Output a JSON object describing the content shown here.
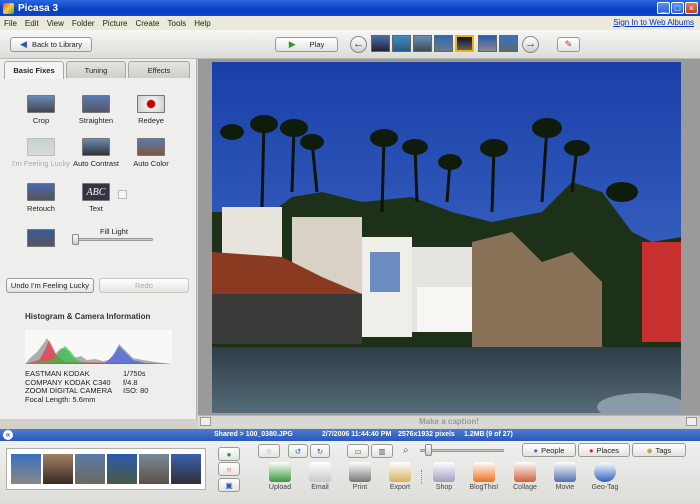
{
  "window": {
    "title": "Picasa 3"
  },
  "menu": {
    "items": [
      "File",
      "Edit",
      "View",
      "Folder",
      "Picture",
      "Create",
      "Tools",
      "Help"
    ],
    "signin": "Sign In to Web Albums"
  },
  "toolbar": {
    "back_label": "Back to Library",
    "play_label": "Play"
  },
  "tabs": [
    {
      "label": "Basic Fixes"
    },
    {
      "label": "Tuning"
    },
    {
      "label": "Effects"
    }
  ],
  "tools": {
    "crop": "Crop",
    "straighten": "Straighten",
    "redeye": "Redeye",
    "lucky": "I'm Feeling Lucky",
    "autocontrast": "Auto Contrast",
    "autocolor": "Auto Color",
    "retouch": "Retouch",
    "text": "Text",
    "filllight": "Fill Light",
    "text_icon": "ABC"
  },
  "buttons": {
    "undo": "Undo I'm Feeling Lucky",
    "redo": "Redo"
  },
  "histogram": {
    "title": "Histogram & Camera Information",
    "camera": [
      "EASTMAN KODAK",
      "COMPANY KODAK C340",
      "ZOOM DIGITAL CAMERA",
      "Focal Length: 5.6mm"
    ],
    "exposure": [
      "1/750s",
      "f/4.8",
      "ISO: 80"
    ]
  },
  "caption": {
    "placeholder": "Make a caption!"
  },
  "infobar": {
    "path": "Shared > 100_0380.JPG",
    "datetime": "2/7/2006 11:44:40 PM",
    "dimensions": "2576x1932 pixels",
    "size": "1.2MB",
    "position": "(9 of 27)"
  },
  "bottom_tabs": {
    "people": "People",
    "places": "Places",
    "tags": "Tags"
  },
  "actions": [
    {
      "label": "Upload",
      "color": "#3a9a3a"
    },
    {
      "label": "Email",
      "color": "#c9c9c9"
    },
    {
      "label": "Print",
      "color": "#777777"
    },
    {
      "label": "Export",
      "color": "#d8b060"
    },
    {
      "label": "Shop",
      "color": "#a0a0c0"
    },
    {
      "label": "BlogThis!",
      "color": "#f07020"
    },
    {
      "label": "Collage",
      "color": "#d06040"
    },
    {
      "label": "Movie",
      "color": "#5070b0"
    },
    {
      "label": "Geo-Tag",
      "color": "#3060c0"
    }
  ]
}
